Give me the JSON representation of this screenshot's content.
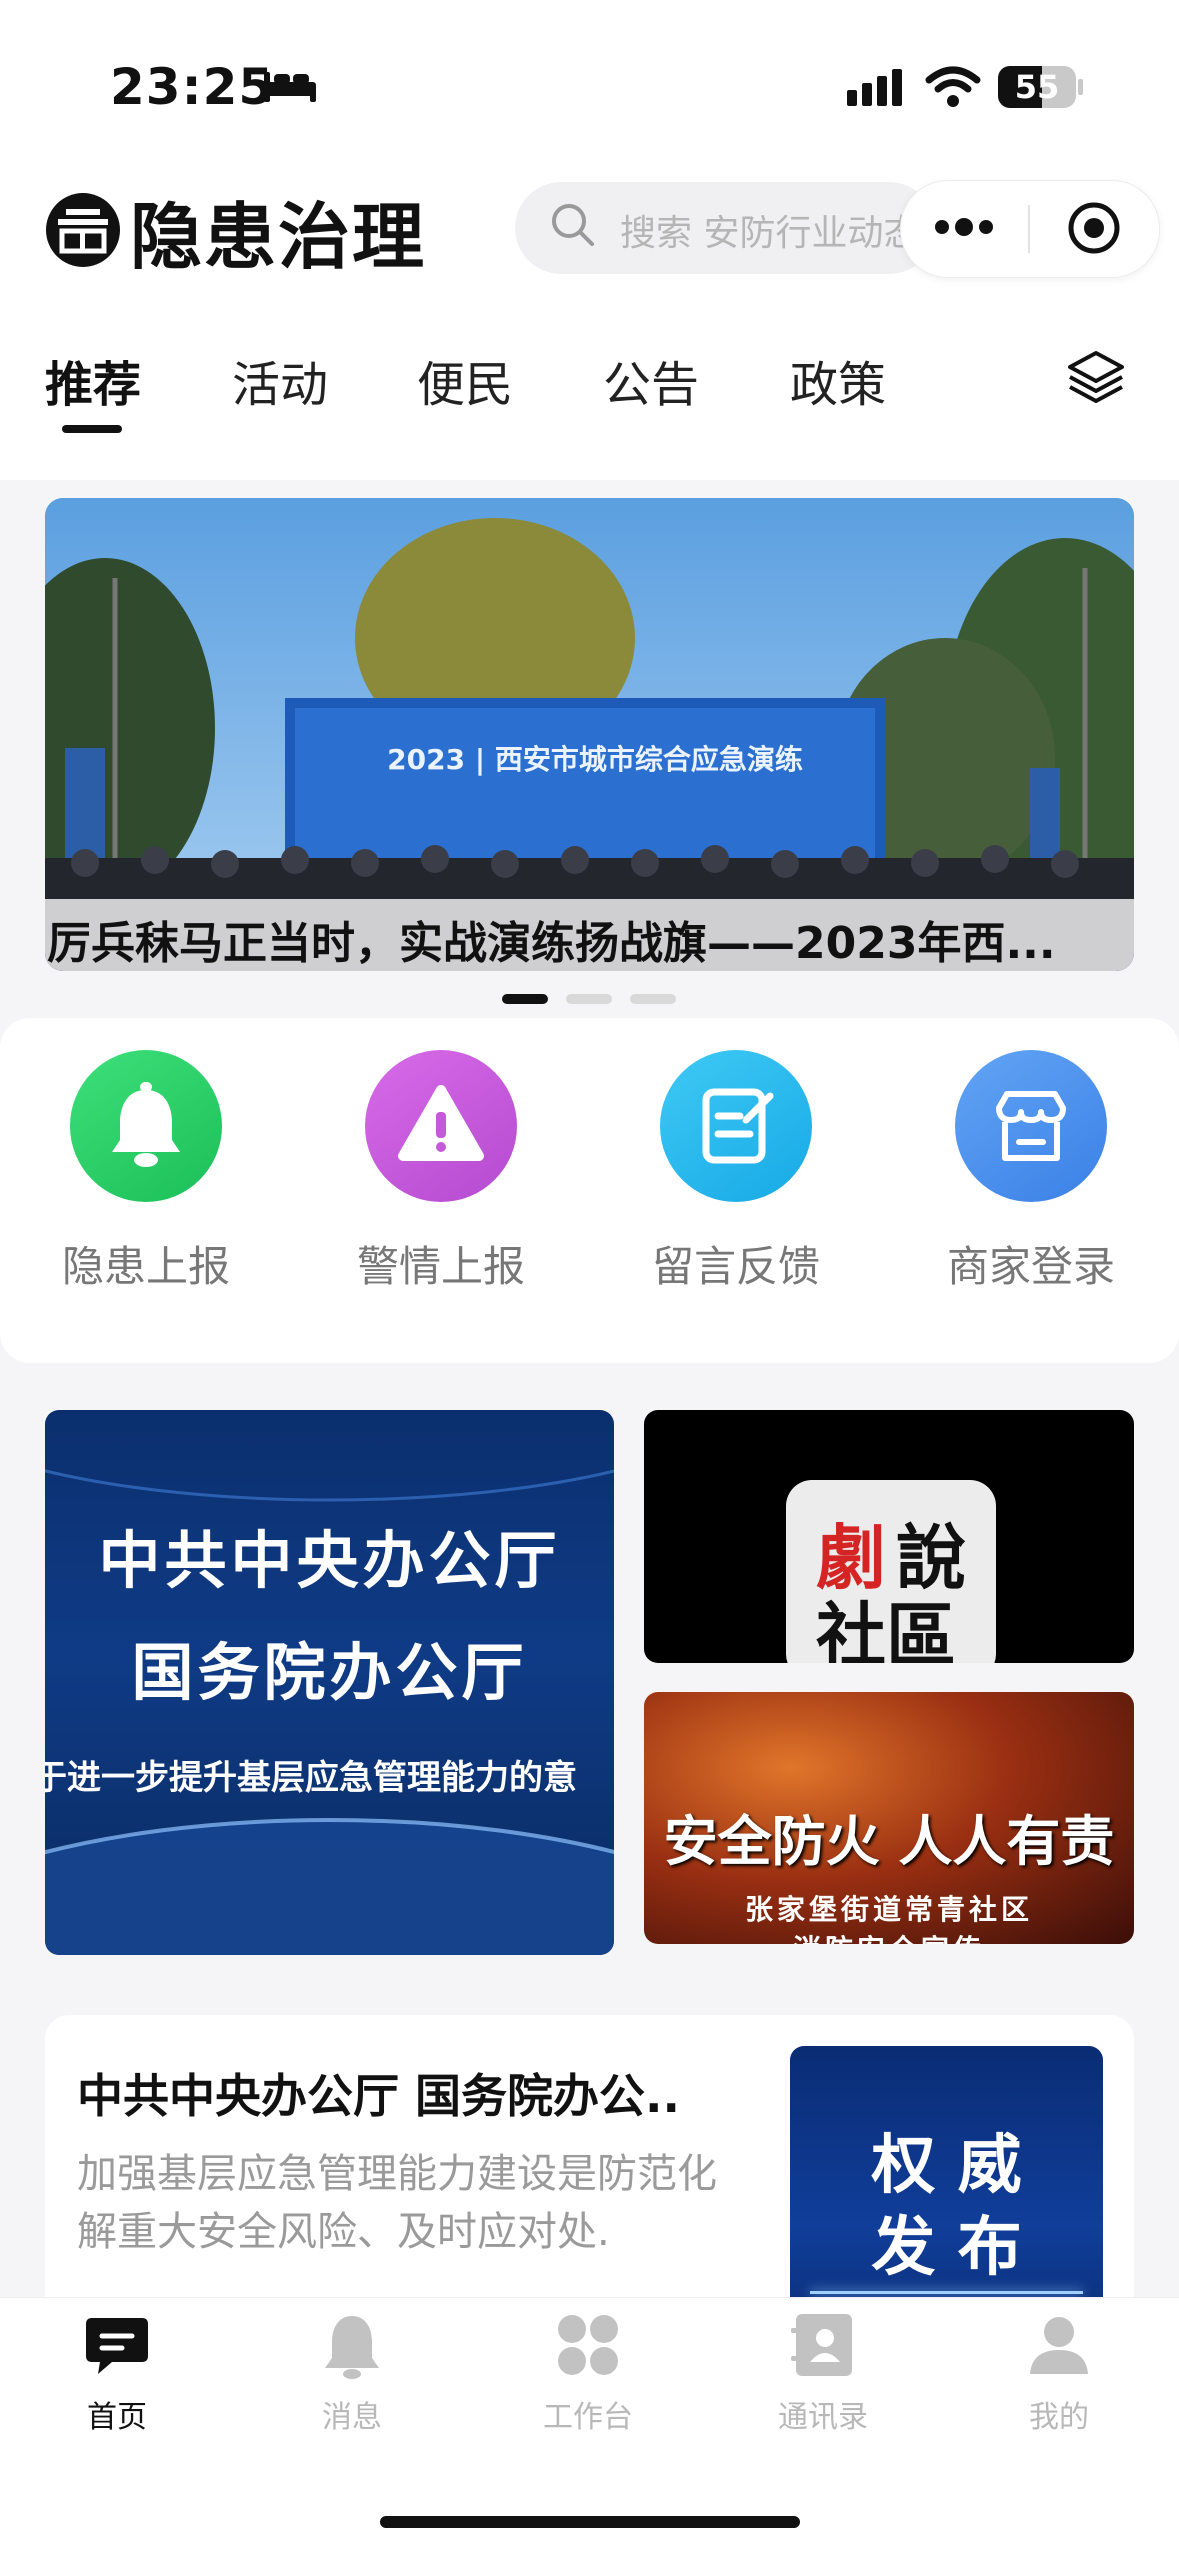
{
  "status_bar": {
    "time": "23:25",
    "battery": "55"
  },
  "header": {
    "title": "隐患治理",
    "search_placeholder": "搜索 安防行业动态"
  },
  "tabs": [
    {
      "label": "推荐",
      "active": true
    },
    {
      "label": "活动",
      "active": false
    },
    {
      "label": "便民",
      "active": false
    },
    {
      "label": "公告",
      "active": false
    },
    {
      "label": "政策",
      "active": false
    }
  ],
  "banner": {
    "sign_text": "2023 | 西安市城市综合应急演练",
    "caption": "厉兵秣马正当时，实战演练扬战旗——2023年西...",
    "active_dot": 0,
    "dot_count": 3
  },
  "quick_actions": [
    {
      "label": "隐患上报",
      "icon": "bell-icon",
      "color": "#2fd168"
    },
    {
      "label": "警情上报",
      "icon": "warning-icon",
      "color": "#c45ad9"
    },
    {
      "label": "留言反馈",
      "icon": "edit-icon",
      "color": "#22b7ef"
    },
    {
      "label": "商家登录",
      "icon": "store-icon",
      "color": "#4a90ef"
    }
  ],
  "tiles": {
    "main": {
      "line1": "中共中央办公厅",
      "line2": "国务院办公厅",
      "line3": "于进一步提升基层应急管理能力的意"
    },
    "top_right": {
      "text1": "劇",
      "text2": "說",
      "text3": "社區"
    },
    "bottom_right": {
      "line1": "安全防火 人人有责",
      "line2": "张家堡街道常青社区",
      "line3": "消防安全宣传"
    }
  },
  "article": {
    "title": "中共中央办公厅 国务院办公..",
    "summary": "加强基层应急管理能力建设是防范化解重大安全风险、及时应对处.",
    "thumb_line1": "权 威",
    "thumb_line2": "发 布"
  },
  "bottom_nav": [
    {
      "label": "首页",
      "icon": "chat-icon",
      "active": true
    },
    {
      "label": "消息",
      "icon": "bell-icon",
      "active": false
    },
    {
      "label": "工作台",
      "icon": "grid-icon",
      "active": false
    },
    {
      "label": "通讯录",
      "icon": "contacts-icon",
      "active": false
    },
    {
      "label": "我的",
      "icon": "user-icon",
      "active": false
    }
  ]
}
